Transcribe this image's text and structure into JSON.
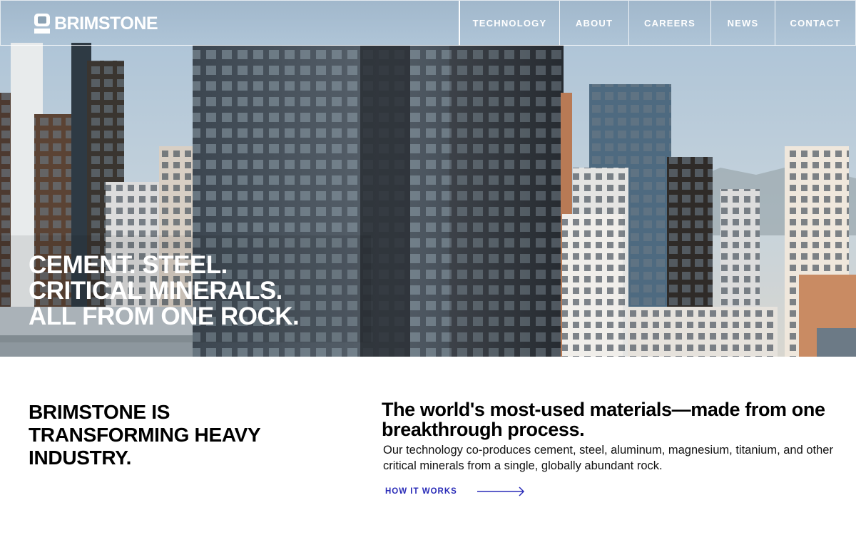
{
  "brand": {
    "name": "BRIMSTONE",
    "text_color": "#ffffff"
  },
  "nav": {
    "items": [
      {
        "label": "TECHNOLOGY",
        "active": true
      },
      {
        "label": "ABOUT",
        "active": false
      },
      {
        "label": "CAREERS",
        "active": false
      },
      {
        "label": "NEWS",
        "active": false
      },
      {
        "label": "CONTACT",
        "active": false
      }
    ]
  },
  "hero": {
    "lines": [
      "CEMENT. STEEL.",
      "CRITICAL MINERALS.",
      "ALL FROM ONE ROCK."
    ],
    "background": "city-skyline-photo"
  },
  "intro": {
    "heading": "BRIMSTONE IS TRANSFORMING HEAVY INDUSTRY."
  },
  "feature": {
    "heading": "The world's most-used materials—made from one breakthrough process.",
    "body": "Our technology co-produces cement, steel, aluminum, magnesium, titanium, and other critical minerals from a single, globally abundant rock.",
    "cta_label": "HOW IT WORKS",
    "cta_icon": "arrow-right-icon",
    "accent_color": "#2a2cb8"
  }
}
